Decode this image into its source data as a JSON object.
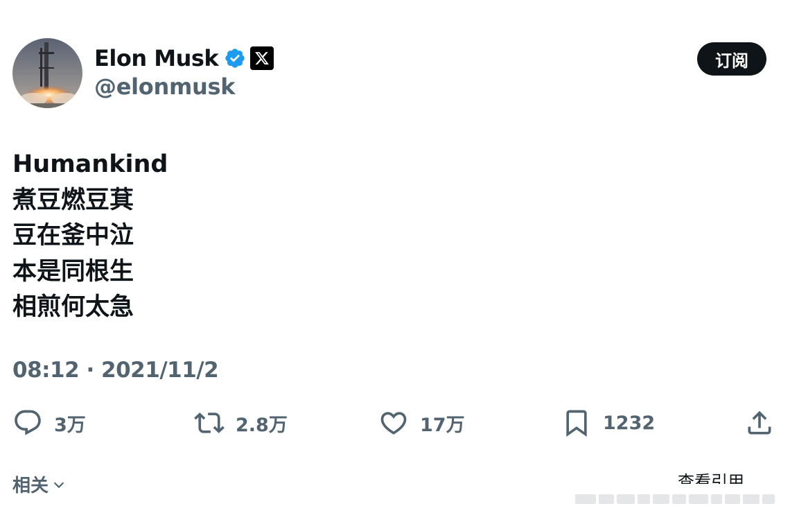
{
  "profile": {
    "display_name": "Elon Musk",
    "handle": "@elonmusk",
    "verified_icon": "verified-badge-icon",
    "affiliate_icon": "x-logo-icon"
  },
  "header": {
    "subscribe_label": "订阅"
  },
  "tweet": {
    "lines": [
      "Humankind",
      "煮豆燃豆萁",
      "豆在釜中泣",
      "本是同根生",
      "相煎何太急"
    ],
    "timestamp": "08:12 · 2021/11/2"
  },
  "actions": {
    "reply_count": "3万",
    "retweet_count": "2.8万",
    "like_count": "17万",
    "bookmark_count": "1232"
  },
  "footer": {
    "related_label": "相关",
    "view_quotes_label": "查看引用"
  },
  "colors": {
    "text": "#0f1419",
    "secondary": "#536471",
    "verified": "#1d9bf0",
    "button": "#0f1419"
  }
}
